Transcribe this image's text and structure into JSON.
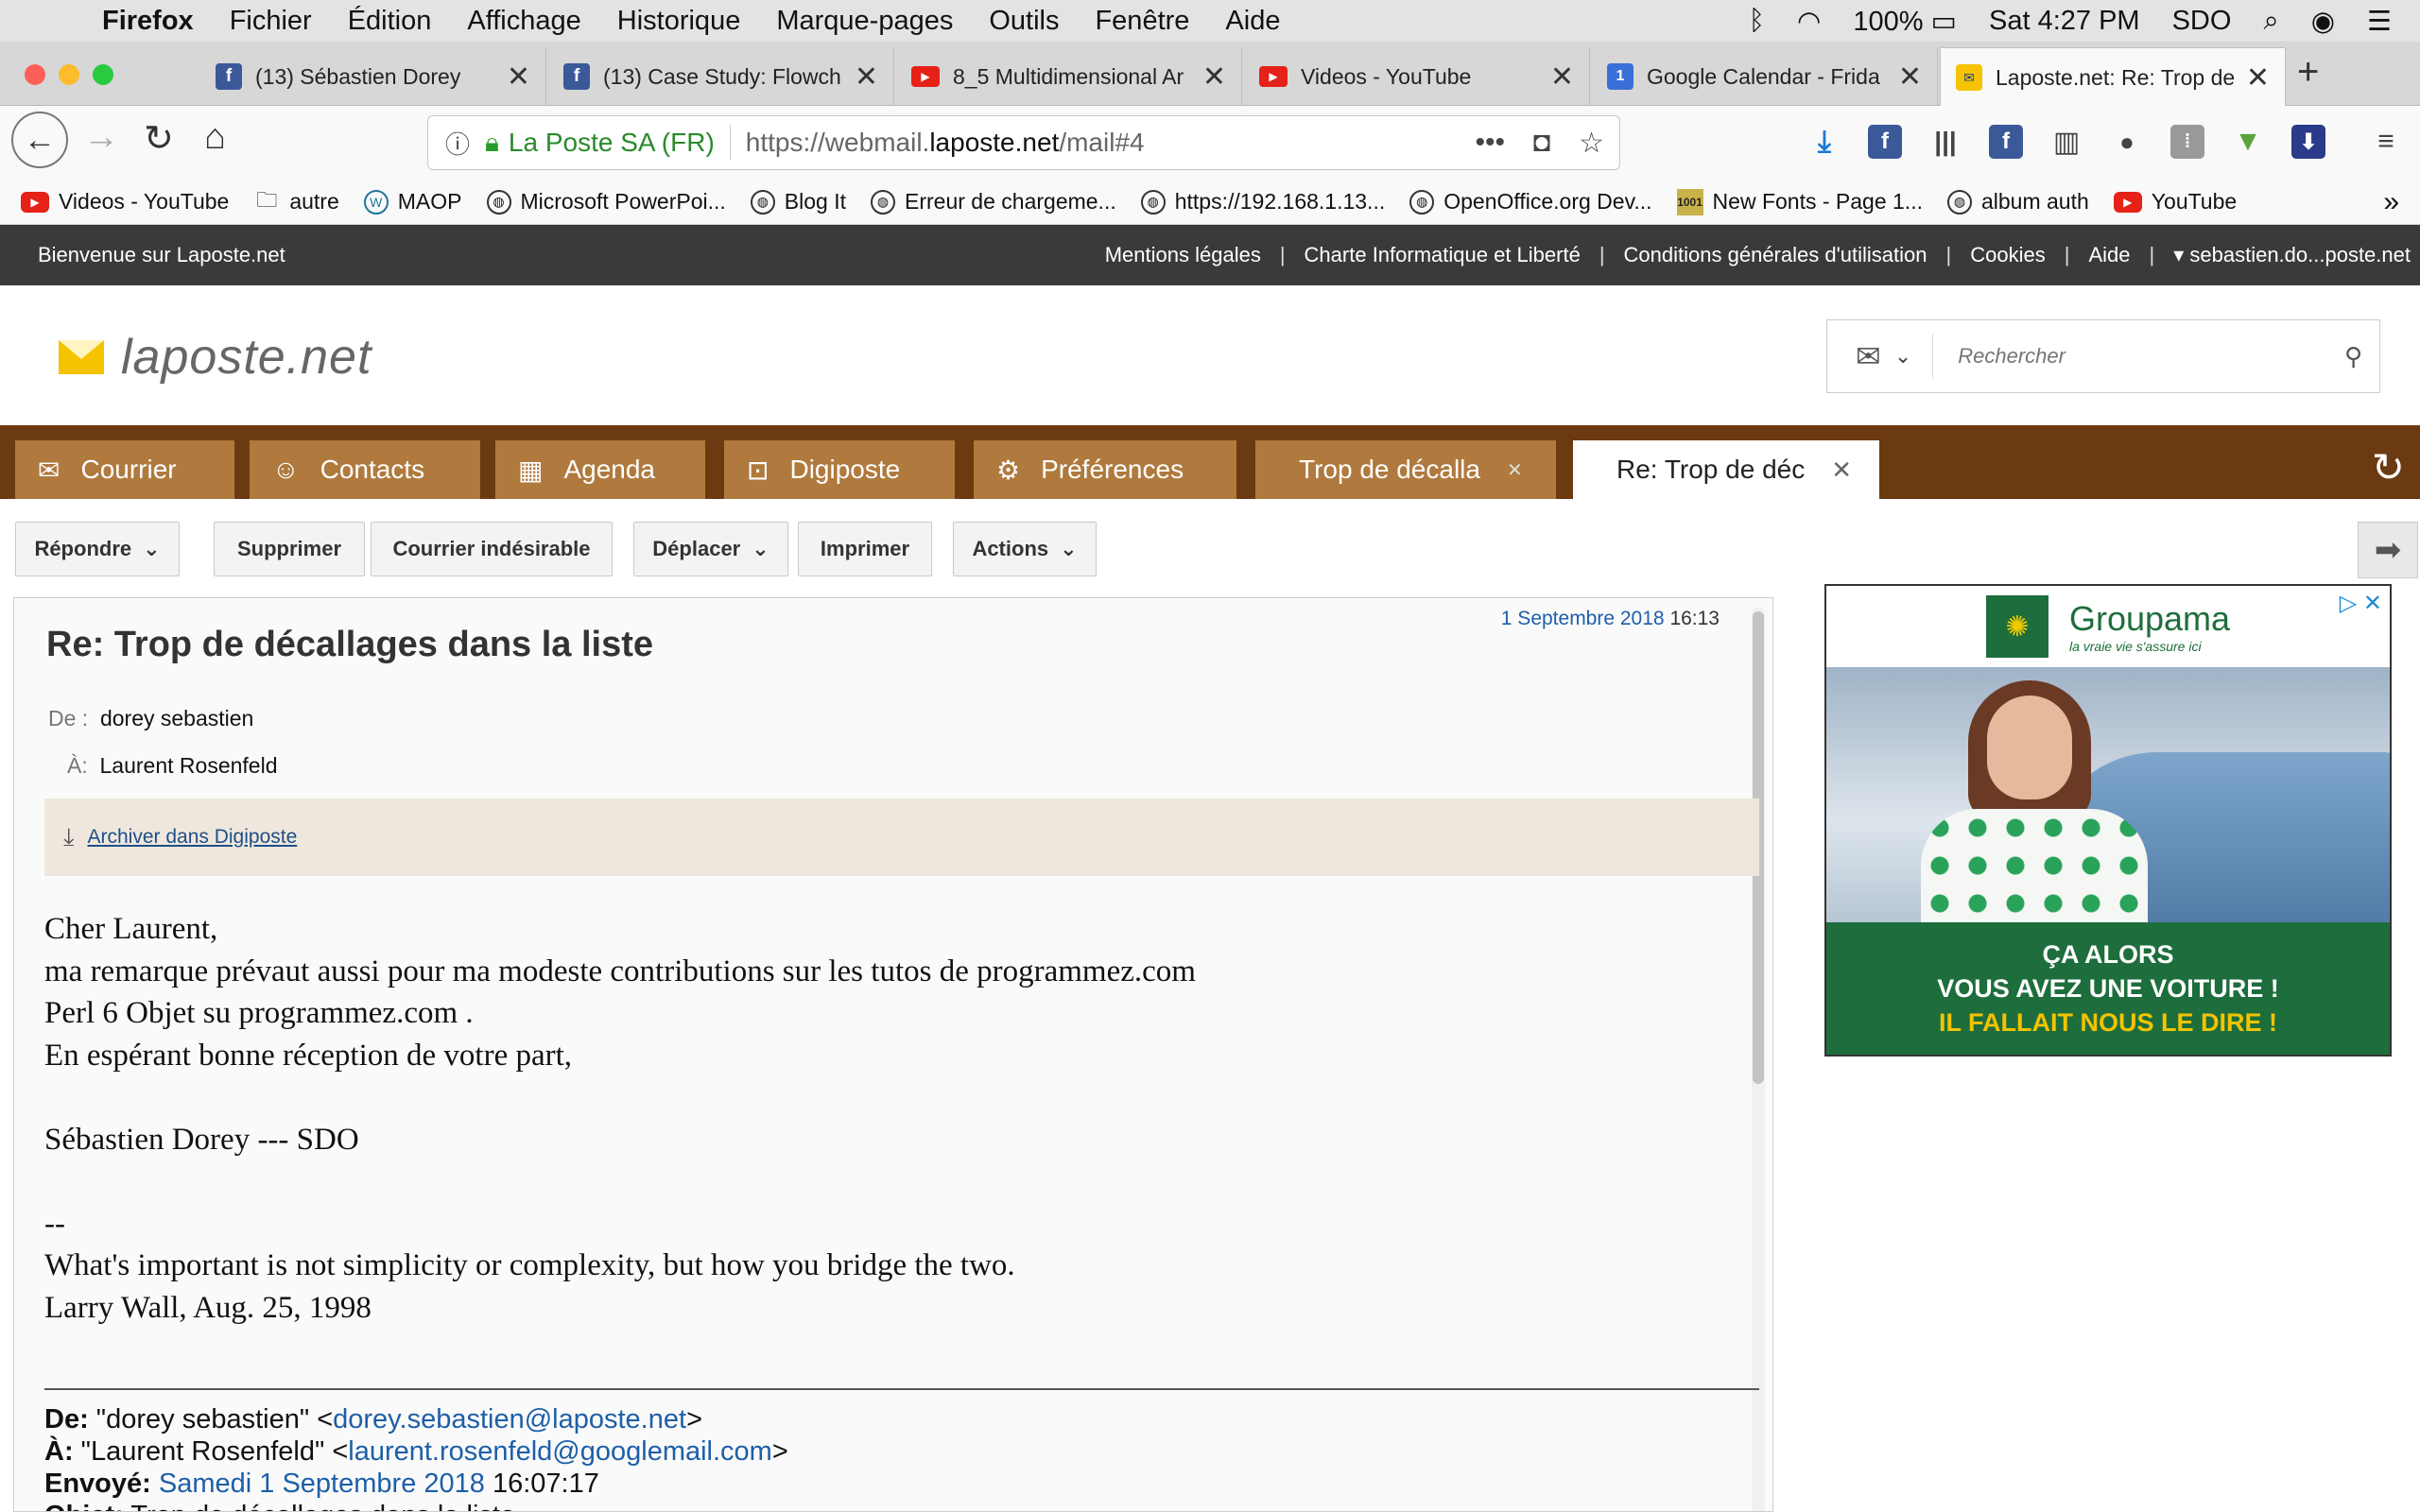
{
  "menubar": {
    "app": "Firefox",
    "items": [
      "Fichier",
      "Édition",
      "Affichage",
      "Historique",
      "Marque-pages",
      "Outils",
      "Fenêtre",
      "Aide"
    ],
    "battery": "100%",
    "clock": "Sat 4:27 PM",
    "user": "SDO"
  },
  "tabs": [
    {
      "title": "(13) Sébastien Dorey",
      "favicon": "facebook-icon"
    },
    {
      "title": "(13) Case Study: Flowch",
      "favicon": "facebook-icon"
    },
    {
      "title": "8_5 Multidimensional Ar",
      "favicon": "youtube-icon"
    },
    {
      "title": "Videos - YouTube",
      "favicon": "youtube-icon"
    },
    {
      "title": "Google Calendar - Frida",
      "favicon": "calendar-icon"
    },
    {
      "title": "Laposte.net: Re: Trop de",
      "favicon": "laposte-icon",
      "active": true
    }
  ],
  "urlbar": {
    "org": "La Poste SA (FR)",
    "url_prefix": "https://webmail.",
    "url_domain": "laposte.net",
    "url_suffix": "/mail#4"
  },
  "bookmarks": [
    {
      "label": "Videos - YouTube",
      "icon": "youtube-icon"
    },
    {
      "label": "autre",
      "icon": "folder-icon"
    },
    {
      "label": "MAOP",
      "icon": "wordpress-icon"
    },
    {
      "label": "Microsoft PowerPoi...",
      "icon": "globe-icon"
    },
    {
      "label": "Blog It",
      "icon": "globe-icon"
    },
    {
      "label": "Erreur de chargeme...",
      "icon": "globe-icon"
    },
    {
      "label": "https://192.168.1.13...",
      "icon": "globe-icon"
    },
    {
      "label": "OpenOffice.org Dev...",
      "icon": "globe-icon"
    },
    {
      "label": "New Fonts - Page 1...",
      "icon": "fonts-icon"
    },
    {
      "label": "album auth",
      "icon": "globe-icon"
    },
    {
      "label": "YouTube",
      "icon": "youtube-icon"
    }
  ],
  "laposte": {
    "welcome": "Bienvenue sur Laposte.net",
    "links": [
      "Mentions légales",
      "Charte Informatique et Liberté",
      "Conditions générales d'utilisation",
      "Cookies",
      "Aide"
    ],
    "account": "sebastien.do...poste.net",
    "logo": "laposte.net",
    "search_placeholder": "Rechercher"
  },
  "nav_tabs": [
    {
      "label": "Courrier",
      "icon": "mail-icon"
    },
    {
      "label": "Contacts",
      "icon": "contacts-icon"
    },
    {
      "label": "Agenda",
      "icon": "calendar-icon"
    },
    {
      "label": "Digiposte",
      "icon": "digiposte-icon"
    },
    {
      "label": "Préférences",
      "icon": "gear-icon"
    },
    {
      "label": "Trop de décalla"
    },
    {
      "label": "Re: Trop de déc",
      "active": true
    }
  ],
  "toolbar": {
    "reply": "Répondre",
    "delete": "Supprimer",
    "spam": "Courrier indésirable",
    "move": "Déplacer",
    "print": "Imprimer",
    "actions": "Actions"
  },
  "message": {
    "date": "1 Septembre 2018",
    "time": "16:13",
    "subject": "Re: Trop de décallages dans la liste",
    "from_label": "De :",
    "from": "dorey sebastien",
    "to_label": "À:",
    "to": "Laurent Rosenfeld",
    "archive": "Archiver dans Digiposte",
    "body": [
      "Cher Laurent,",
      "ma remarque prévaut aussi pour ma modeste contributions sur les tutos de programmez.com",
      "Perl 6 Objet su programmez.com .",
      "En espérant bonne réception de votre part,",
      "",
      "Sébastien Dorey --- SDO",
      "",
      "--",
      "What's important is not simplicity or complexity, but how you bridge the two.",
      "Larry Wall, Aug. 25, 1998"
    ],
    "quoted": {
      "from_label": "De:",
      "from_name": "\"dorey sebastien\"",
      "from_email": "dorey.sebastien@laposte.net",
      "to_label": "À:",
      "to_name": "\"Laurent Rosenfeld\"",
      "to_email": "laurent.rosenfeld@googlemail.com",
      "sent_label": "Envoyé:",
      "sent_date": "Samedi 1 Septembre 2018",
      "sent_time": "16:07:17",
      "subject_label": "Objet:",
      "subject": "Trop de décallages dans la liste"
    }
  },
  "ad": {
    "brand": "Groupama",
    "tagline": "la vraie vie s'assure ici",
    "line1": "ÇA ALORS",
    "line2": "VOUS AVEZ UNE VOITURE !",
    "line3": "IL FALLAIT NOUS LE DIRE !"
  }
}
